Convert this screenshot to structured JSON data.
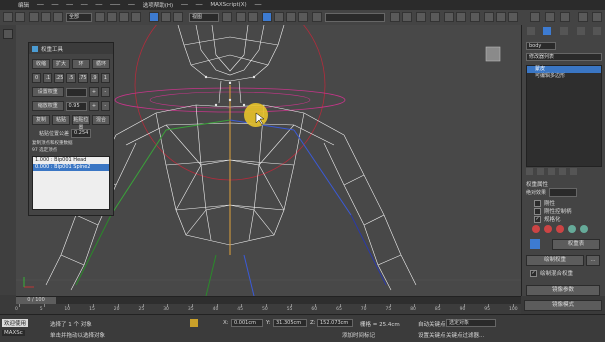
{
  "menubar": {
    "items": [
      "编辑",
      "",
      "",
      "",
      "",
      "",
      "",
      "选项帮助(H)",
      "",
      "",
      "MAXScript(X)",
      "",
      "",
      ""
    ]
  },
  "toolbar": {
    "selection_filter": "全部",
    "view_coord": "视图",
    "named_selection": ""
  },
  "skin_panel": {
    "title": "权重工具",
    "row1": [
      "收缩",
      "扩大",
      "环",
      "循环"
    ],
    "row2": [
      "0",
      ".1",
      ".25",
      ".5",
      ".75",
      ".9",
      "1"
    ],
    "set_weight_label": "设置权重",
    "set_weight_value": "",
    "scale_weight_label": "缩放权重",
    "scale_weight_value": "0.95",
    "row5": [
      "复制",
      "粘贴",
      "粘贴位置",
      "混合"
    ],
    "paste_tolerance_label": "粘贴位置公差",
    "paste_tolerance_value": "0.254",
    "copy_note": "复制顶点和权重数据",
    "selected_count": "97 选定顶点",
    "list": [
      {
        "text": "1.000 : Bip001 Head",
        "selected": false
      },
      {
        "text": "0.000 : Bip001 Spine2",
        "selected": true
      }
    ]
  },
  "command_panel": {
    "object_name": "body",
    "modifier_list_label": "修改器列表",
    "stack": [
      {
        "text": "蒙皮",
        "selected": true
      },
      {
        "text": "可编辑多边形",
        "selected": false
      }
    ],
    "weight_props_title": "权重属性",
    "local_effect_label": "绝对效果",
    "rigid_label": "刚性",
    "rigid_handles_label": "刚性控制柄",
    "normalize_label": "规格化",
    "weight_table_label": "权重表",
    "paint_weights_label": "绘制权重",
    "paint_blend_label": "绘制混合权重",
    "mirror_params_label": "镜像参数",
    "mirror_mode_label": "镜像模式",
    "normalize_checked": true,
    "paint_blend_checked": true
  },
  "timeline": {
    "frame_display": "0 / 100",
    "ticks": [
      "0",
      "5",
      "10",
      "15",
      "20",
      "25",
      "30",
      "35",
      "40",
      "45",
      "50",
      "55",
      "60",
      "65",
      "70",
      "75",
      "80",
      "85",
      "90",
      "95",
      "100"
    ]
  },
  "status": {
    "welcome": "欢迎使用",
    "maxscript": "MAXSc",
    "selected_info": "选择了 1 个 对象",
    "hint": "单击并拖动以选择对象",
    "x_label": "X:",
    "x_value": "0.001cm",
    "y_label": "Y:",
    "y_value": "31.305cm",
    "z_label": "Z:",
    "z_value": "152.073cm",
    "grid_label": "栅格 = 25.4cm",
    "add_time_tag": "添加时间标记",
    "auto_key": "自动关键点",
    "selected_obj_label": "选定对象",
    "set_key": "设置关键点",
    "key_filters": "关键点过滤器..."
  }
}
